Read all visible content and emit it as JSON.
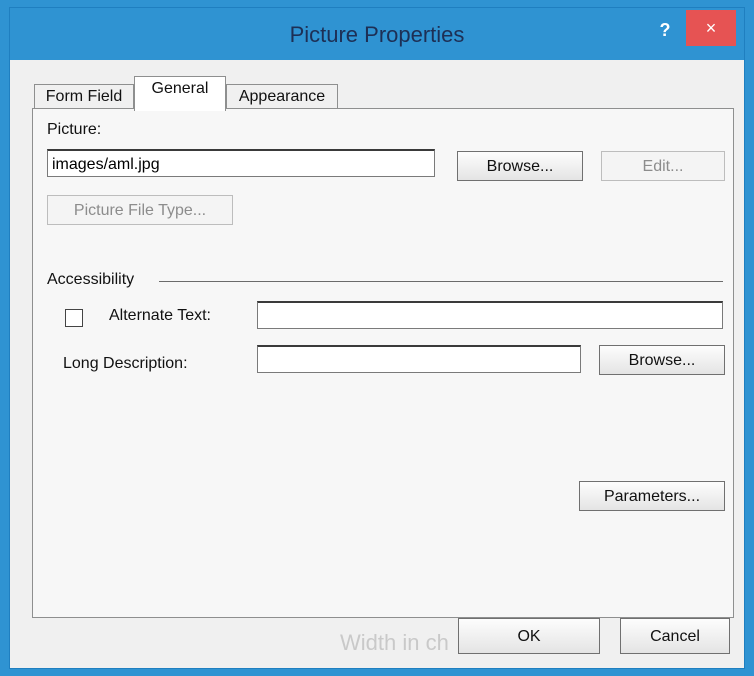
{
  "window": {
    "title": "Picture Properties",
    "help_symbol": "?",
    "close_symbol": "×"
  },
  "tabs": [
    {
      "label": "Form Field"
    },
    {
      "label": "General"
    },
    {
      "label": "Appearance"
    }
  ],
  "picture": {
    "label": "Picture:",
    "value": "images/aml.jpg",
    "browse_label": "Browse...",
    "edit_label": "Edit...",
    "file_type_label": "Picture File Type..."
  },
  "accessibility": {
    "section_label": "Accessibility",
    "alternate_text_label": "Alternate Text:",
    "alternate_text_value": "",
    "long_description_label": "Long Description:",
    "long_description_value": "",
    "browse_label": "Browse..."
  },
  "parameters_label": "Parameters...",
  "footer": {
    "background_text": "Width in ch",
    "ok_label": "OK",
    "cancel_label": "Cancel"
  }
}
